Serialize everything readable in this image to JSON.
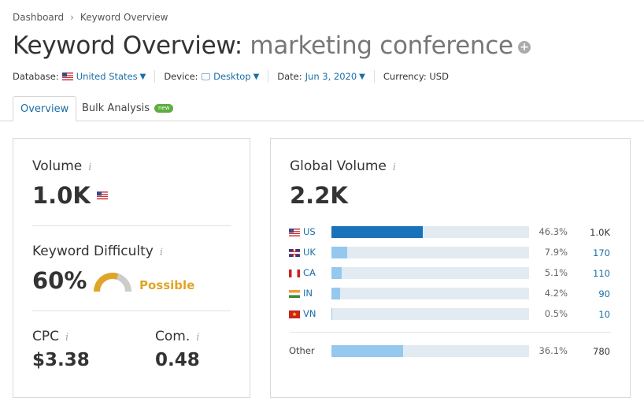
{
  "breadcrumb": [
    "Dashboard",
    "Keyword Overview"
  ],
  "title": {
    "prefix": "Keyword Overview:",
    "keyword": "marketing conference",
    "add_icon": "plus-circle-icon"
  },
  "filters": {
    "database_label": "Database:",
    "database_value": "United States",
    "device_label": "Device:",
    "device_value": "Desktop",
    "date_label": "Date:",
    "date_value": "Jun 3, 2020",
    "currency_label": "Currency: USD"
  },
  "tabs": [
    {
      "label": "Overview",
      "active": true
    },
    {
      "label": "Bulk Analysis",
      "badge": "new"
    }
  ],
  "volume": {
    "label": "Volume",
    "value": "1.0K"
  },
  "difficulty": {
    "label": "Keyword Difficulty",
    "value": "60%",
    "percent": 60,
    "rating": "Possible",
    "color": "#e0a526"
  },
  "cpc": {
    "label": "CPC",
    "value": "$3.38"
  },
  "competition": {
    "label": "Com.",
    "value": "0.48"
  },
  "global": {
    "label": "Global Volume",
    "value": "2.2K",
    "countries": [
      {
        "code": "US",
        "flag": "us",
        "percent_label": "46.3%",
        "percent": 46.3,
        "volume": "1.0K"
      },
      {
        "code": "UK",
        "flag": "uk",
        "percent_label": "7.9%",
        "percent": 7.9,
        "volume": "170"
      },
      {
        "code": "CA",
        "flag": "ca",
        "percent_label": "5.1%",
        "percent": 5.1,
        "volume": "110"
      },
      {
        "code": "IN",
        "flag": "in",
        "percent_label": "4.2%",
        "percent": 4.2,
        "volume": "90"
      },
      {
        "code": "VN",
        "flag": "vn",
        "percent_label": "0.5%",
        "percent": 0.5,
        "volume": "10"
      }
    ],
    "other": {
      "label": "Other",
      "percent_label": "36.1%",
      "percent": 36.1,
      "volume": "780"
    },
    "colors": {
      "primary": "#1a73ba",
      "secondary": "#95c8ee",
      "track": "#e3ebf2"
    }
  }
}
